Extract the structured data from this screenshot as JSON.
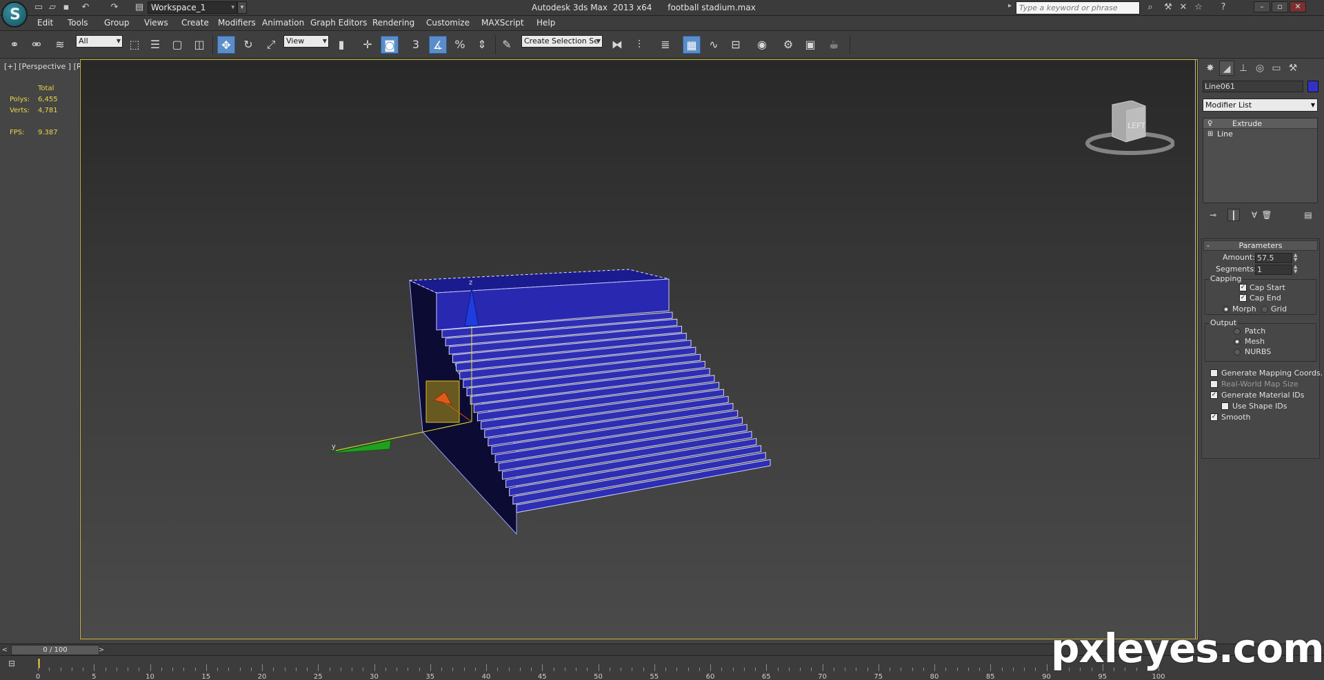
{
  "titlebar": {
    "workspace": "Workspace_1",
    "app_title": "Autodesk 3ds Max  2013 x64      football stadium.max",
    "search_placeholder": "Type a keyword or phrase"
  },
  "menu": [
    "Edit",
    "Tools",
    "Group",
    "Views",
    "Create",
    "Modifiers",
    "Animation",
    "Graph Editors",
    "Rendering",
    "Customize",
    "MAXScript",
    "Help"
  ],
  "toolbar": {
    "selection_filter": "All",
    "reference_coord": "View",
    "named_selection": "Create Selection Se",
    "snap_value": "3"
  },
  "viewport": {
    "label": "[+] [Perspective ] [Realistic + Edged Faces ]",
    "stats": {
      "header": "Total",
      "polys_label": "Polys:",
      "polys": "6,455",
      "verts_label": "Verts:",
      "verts": "4,781",
      "fps_label": "FPS:",
      "fps": "9.387"
    },
    "axis_z": "z",
    "axis_y": "y",
    "viewcube_face": "LEFT",
    "object_color": "#2e2eb4"
  },
  "command_panel": {
    "object_name": "Line061",
    "object_color": "#3232c8",
    "modifier_list": "Modifier List",
    "stack": [
      "Extrude",
      "Line"
    ],
    "params_title": "Parameters",
    "amount_label": "Amount:",
    "amount": "57.5",
    "segments_label": "Segments:",
    "segments": "1",
    "capping_title": "Capping",
    "cap_start": "Cap Start",
    "cap_end": "Cap End",
    "morph": "Morph",
    "grid": "Grid",
    "output_title": "Output",
    "patch": "Patch",
    "mesh": "Mesh",
    "nurbs": "NURBS",
    "gen_mapping": "Generate Mapping Coords.",
    "real_world": "Real-World Map Size",
    "gen_matids": "Generate Material IDs",
    "use_shape_ids": "Use Shape IDs",
    "smooth": "Smooth"
  },
  "timeline": {
    "frame_display": "0 / 100",
    "ticks": [
      "0",
      "5",
      "10",
      "15",
      "20",
      "25",
      "30",
      "35",
      "40",
      "45",
      "50",
      "55",
      "60",
      "65",
      "70",
      "75",
      "80",
      "85",
      "90",
      "95",
      "100"
    ]
  },
  "watermark": "pxleyes.com"
}
